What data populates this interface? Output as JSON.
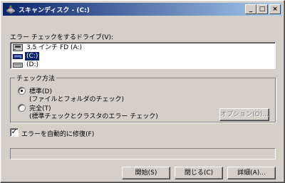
{
  "window": {
    "title": "スキャンディスク - (C:)",
    "minimize_glyph": "_",
    "maximize_glyph": "□",
    "close_glyph": "×"
  },
  "drives": {
    "label": "エラー チェックをするドライブ(V):",
    "items": [
      {
        "label": "3.5 インチ FD (A:)",
        "icon": "floppy-drive-icon",
        "selected": false
      },
      {
        "label": "(C:)",
        "icon": "hard-drive-icon",
        "selected": true
      },
      {
        "label": "(D:)",
        "icon": "hard-drive-icon",
        "selected": false
      }
    ]
  },
  "check_method": {
    "legend": "チェック方法",
    "standard": {
      "label": "標準(D)",
      "description": "(ファイルとフォルダのチェック)",
      "selected": true
    },
    "thorough": {
      "label": "完全(T)",
      "description": "(標準チェックとクラスタのエラー チェック)",
      "selected": false
    },
    "options_button": "オプション(O)..."
  },
  "auto_fix": {
    "label": "エラーを自動的に修復(F)",
    "checked": true
  },
  "progress": {
    "value": 0
  },
  "buttons": {
    "start": "開始(S)",
    "close": "閉じる(C)",
    "advanced": "詳細(A)..."
  },
  "colors": {
    "face": "#d4d0c8",
    "title_start": "#0a246a",
    "title_end": "#a6caf0",
    "selection": "#0a246a"
  }
}
